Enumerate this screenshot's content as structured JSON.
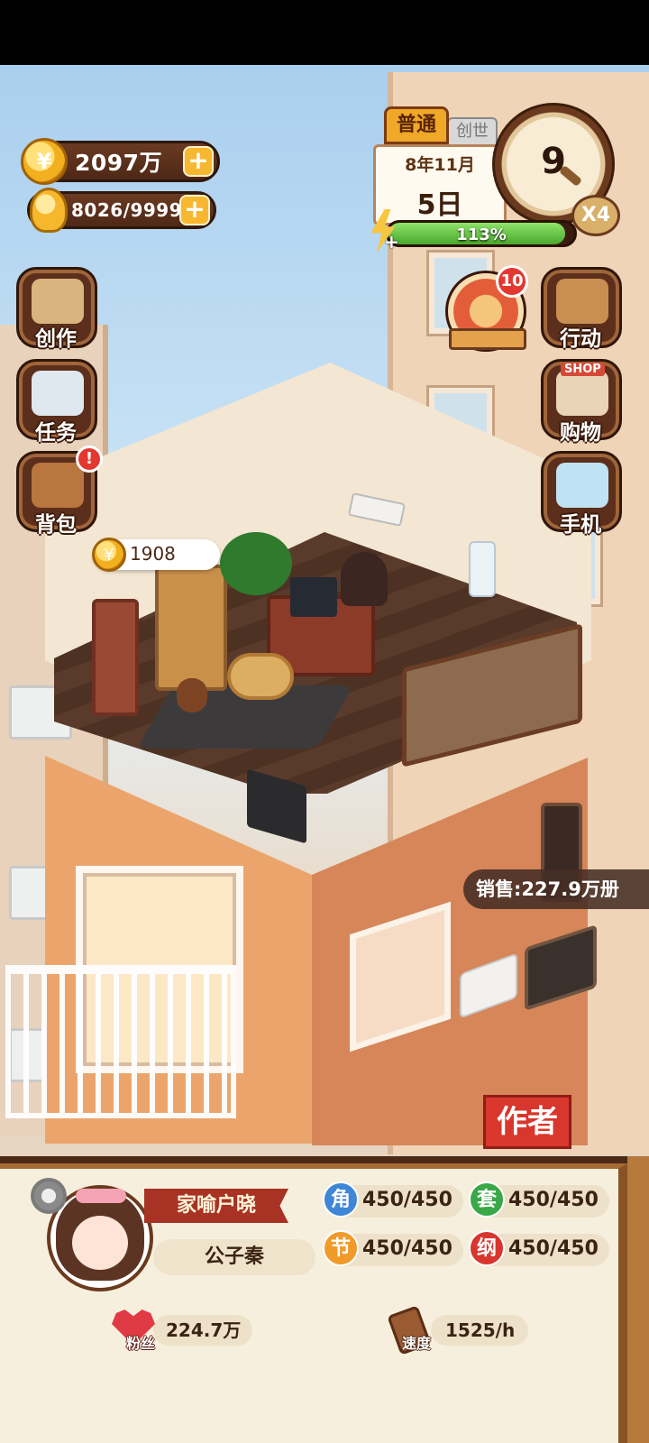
{
  "resources": {
    "coins": "2097万",
    "energy": "8026/9999",
    "add_label": "+"
  },
  "calendar": {
    "mode": "普通",
    "mode_alt": "创世",
    "month": "8年11月",
    "day": "5日",
    "clock_value": "9",
    "speed": "X4",
    "stamina_text": "113%",
    "stamina_fraction": 0.95
  },
  "side_menu_left": [
    {
      "label": "创作",
      "icon": "book-icon"
    },
    {
      "label": "任务",
      "icon": "checklist-icon"
    },
    {
      "label": "背包",
      "icon": "bag-icon",
      "alert": "!"
    }
  ],
  "side_menu_right": [
    {
      "label": "行动",
      "icon": "door-icon"
    },
    {
      "label": "购物",
      "icon": "shop-icon",
      "sign": "SHOP"
    },
    {
      "label": "手机",
      "icon": "phone-icon"
    }
  ],
  "wheel": {
    "badge": "10"
  },
  "room": {
    "coin_bubble": "1908",
    "sales": "销售:227.9万册",
    "author_button": "作者"
  },
  "profile": {
    "pen_name": "家喻户晓",
    "name": "公子秦",
    "stats": [
      {
        "key": "角",
        "value": "450/450",
        "color": "#3f86d6"
      },
      {
        "key": "套",
        "value": "450/450",
        "color": "#3aa847"
      },
      {
        "key": "节",
        "value": "450/450",
        "color": "#f09a2a"
      },
      {
        "key": "纲",
        "value": "450/450",
        "color": "#d8362f"
      }
    ],
    "fans_label": "粉丝",
    "fans_value": "224.7万",
    "speed_label": "速度",
    "speed_value": "1525/h"
  }
}
